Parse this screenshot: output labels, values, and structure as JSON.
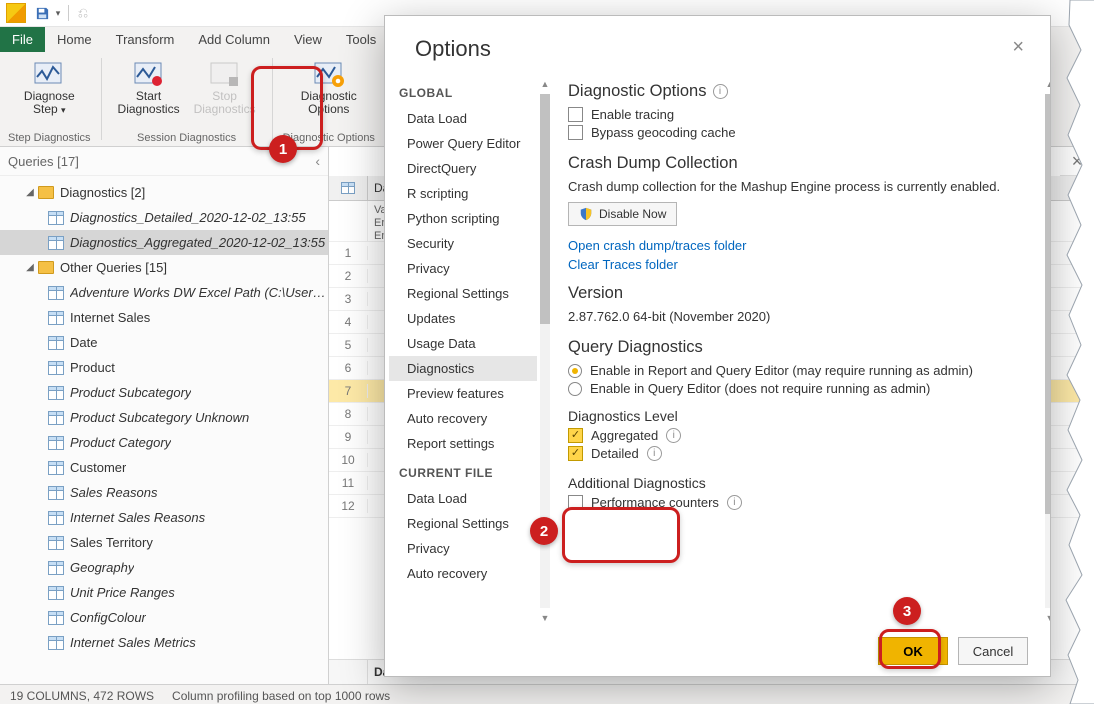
{
  "titlebar": {
    "save_icon": "save",
    "undo_icon": "undo"
  },
  "ribbon": {
    "tabs": [
      "File",
      "Home",
      "Transform",
      "Add Column",
      "View",
      "Tools"
    ],
    "groups": [
      {
        "title": "Step Diagnostics",
        "buttons": [
          {
            "label": "Diagnose\nStep",
            "dropdown": true
          }
        ]
      },
      {
        "title": "Session Diagnostics",
        "buttons": [
          {
            "label": "Start\nDiagnostics"
          },
          {
            "label": "Stop\nDiagnostics"
          }
        ]
      },
      {
        "title": "Diagnostic Options",
        "buttons": [
          {
            "label": "Diagnostic\nOptions"
          }
        ]
      }
    ]
  },
  "queries": {
    "header": "Queries [17]",
    "tree": [
      {
        "type": "folder",
        "label": "Diagnostics [2]",
        "children": [
          {
            "type": "table",
            "label": "Diagnostics_Detailed_2020-12-02_13:55",
            "italic": true
          },
          {
            "type": "table",
            "label": "Diagnostics_Aggregated_2020-12-02_13:55",
            "italic": true,
            "selected": true
          }
        ]
      },
      {
        "type": "folder",
        "label": "Other Queries [15]",
        "children": [
          {
            "type": "table",
            "label": "Adventure Works DW Excel Path (C:\\Users\\so...",
            "italic": true
          },
          {
            "type": "table",
            "label": "Internet Sales"
          },
          {
            "type": "table",
            "label": "Date"
          },
          {
            "type": "table",
            "label": "Product"
          },
          {
            "type": "table",
            "label": "Product Subcategory",
            "italic": true
          },
          {
            "type": "table",
            "label": "Product Subcategory Unknown",
            "italic": true
          },
          {
            "type": "table",
            "label": "Product Category",
            "italic": true
          },
          {
            "type": "table",
            "label": "Customer"
          },
          {
            "type": "table",
            "label": "Sales Reasons",
            "italic": true
          },
          {
            "type": "table",
            "label": "Internet Sales Reasons",
            "italic": true
          },
          {
            "type": "table",
            "label": "Sales Territory"
          },
          {
            "type": "table",
            "label": "Geography",
            "italic": true
          },
          {
            "type": "table",
            "label": "Unit Price Ranges",
            "italic": true
          },
          {
            "type": "table",
            "label": "ConfigColour",
            "italic": true
          },
          {
            "type": "table",
            "label": "Internet Sales Metrics",
            "italic": true
          }
        ]
      }
    ]
  },
  "preview": {
    "col1_frag": "Da",
    "val_frag": "Val",
    "err_frag": "Err",
    "emp_frag": "Em",
    "rows": [
      1,
      2,
      3,
      4,
      5,
      6,
      7,
      8,
      9,
      10,
      11,
      12
    ],
    "selected_row": 7,
    "footer_label": "Dat"
  },
  "status": {
    "left": "19 COLUMNS, 472 ROWS",
    "right": "Column profiling based on top 1000 rows"
  },
  "dialog": {
    "title": "Options",
    "close": "×",
    "nav": {
      "groups": [
        {
          "label": "GLOBAL",
          "items": [
            "Data Load",
            "Power Query Editor",
            "DirectQuery",
            "R scripting",
            "Python scripting",
            "Security",
            "Privacy",
            "Regional Settings",
            "Updates",
            "Usage Data",
            "Diagnostics",
            "Preview features",
            "Auto recovery",
            "Report settings"
          ],
          "selected": "Diagnostics"
        },
        {
          "label": "CURRENT FILE",
          "items": [
            "Data Load",
            "Regional Settings",
            "Privacy",
            "Auto recovery"
          ]
        }
      ]
    },
    "content": {
      "diagOptions": {
        "heading": "Diagnostic Options",
        "enable_tracing": "Enable tracing",
        "bypass_geo": "Bypass geocoding cache"
      },
      "crash": {
        "heading": "Crash Dump Collection",
        "desc": "Crash dump collection for the Mashup Engine process is currently enabled.",
        "disable_btn": "Disable Now",
        "link1": "Open crash dump/traces folder",
        "link2": "Clear Traces folder"
      },
      "version": {
        "heading": "Version",
        "value": "2.87.762.0 64-bit (November 2020)"
      },
      "queryDiag": {
        "heading": "Query Diagnostics",
        "opt1": "Enable in Report and Query Editor (may require running as admin)",
        "opt2": "Enable in Query Editor (does not require running as admin)",
        "level_heading": "Diagnostics Level",
        "aggregated": "Aggregated",
        "detailed": "Detailed",
        "addl_heading": "Additional Diagnostics",
        "perf": "Performance counters"
      }
    },
    "buttons": {
      "ok": "OK",
      "cancel": "Cancel"
    }
  },
  "annotations": {
    "n1": "1",
    "n2": "2",
    "n3": "3"
  }
}
